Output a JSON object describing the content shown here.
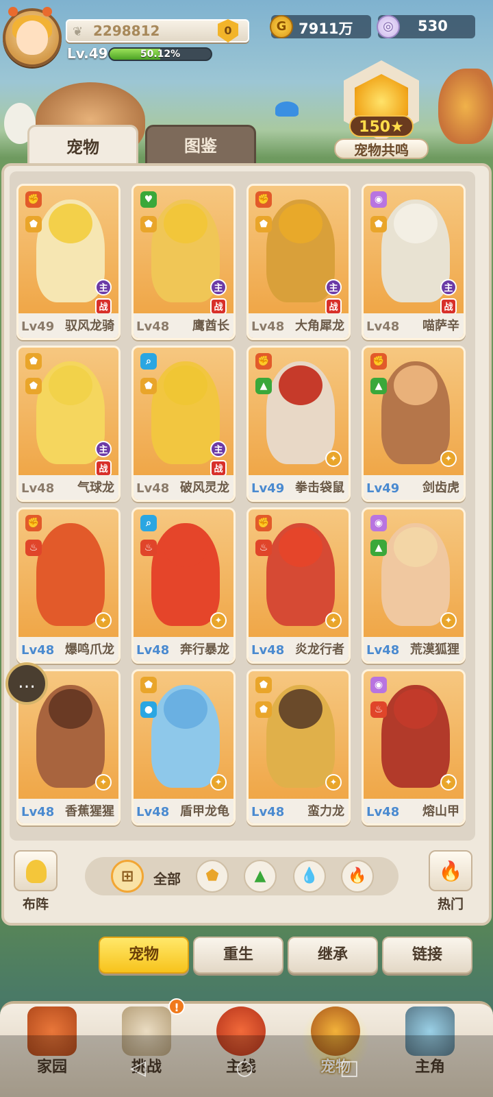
{
  "player": {
    "score": "2298812",
    "rank_badge": "0",
    "level": "Lv.49",
    "exp_percent": "50.12%",
    "exp_value": 0.5012
  },
  "currency": {
    "gold": "7911万",
    "gems": "530"
  },
  "resonance": {
    "count": "150★",
    "label": "宠物共鸣"
  },
  "tabs": [
    {
      "label": "宠物",
      "active": true
    },
    {
      "label": "图鉴",
      "active": false
    }
  ],
  "pets": [
    {
      "level": "Lv49",
      "name": "驭风龙骑",
      "stars": "★",
      "main": "主",
      "battle": "战"
    },
    {
      "level": "Lv48",
      "name": "鹰酋长",
      "stars": "★★★★",
      "main": "主",
      "battle": "战"
    },
    {
      "level": "Lv48",
      "name": "大角犀龙",
      "stars": "★★★★",
      "main": "主",
      "battle": "战"
    },
    {
      "level": "Lv48",
      "name": "喵萨辛",
      "stars": "★★★",
      "main": "主",
      "battle": "战"
    },
    {
      "level": "Lv48",
      "name": "气球龙",
      "stars": "★★★",
      "main": "主",
      "battle": "战"
    },
    {
      "level": "Lv48",
      "name": "破风灵龙",
      "stars": "★★",
      "main": "主",
      "battle": "战"
    },
    {
      "level": "Lv49",
      "name": "拳击袋鼠",
      "stars": "★★"
    },
    {
      "level": "Lv49",
      "name": "剑齿虎",
      "stars": "★"
    },
    {
      "level": "Lv48",
      "name": "爆鸣爪龙",
      "stars": "★"
    },
    {
      "level": "Lv48",
      "name": "奔行暴龙",
      "stars": "★"
    },
    {
      "level": "Lv48",
      "name": "炎龙行者",
      "stars": "★★★"
    },
    {
      "level": "Lv48",
      "name": "荒漠狐狸",
      "stars": "★★★"
    },
    {
      "level": "Lv48",
      "name": "香蕉猩猩",
      "stars": "★★★"
    },
    {
      "level": "Lv48",
      "name": "盾甲龙龟",
      "stars": "★★"
    },
    {
      "level": "Lv48",
      "name": "蛮力龙",
      "stars": "★★"
    },
    {
      "level": "Lv48",
      "name": "熔山甲",
      "stars": "★★"
    }
  ],
  "filter": {
    "formation_label": "布阵",
    "all_label": "全部",
    "hot_label": "热门"
  },
  "actions": [
    {
      "label": "宠物",
      "active": true
    },
    {
      "label": "重生",
      "active": false
    },
    {
      "label": "继承",
      "active": false
    },
    {
      "label": "链接",
      "active": false
    }
  ],
  "nav": [
    {
      "label": "家园"
    },
    {
      "label": "挑战",
      "badge": "!"
    },
    {
      "label": "主线"
    },
    {
      "label": "宠物",
      "active": true
    },
    {
      "label": "主角"
    }
  ],
  "colors": {
    "accent": "#f7c31c",
    "card": "#f0a84a",
    "level_blue": "#4a8ad0"
  }
}
